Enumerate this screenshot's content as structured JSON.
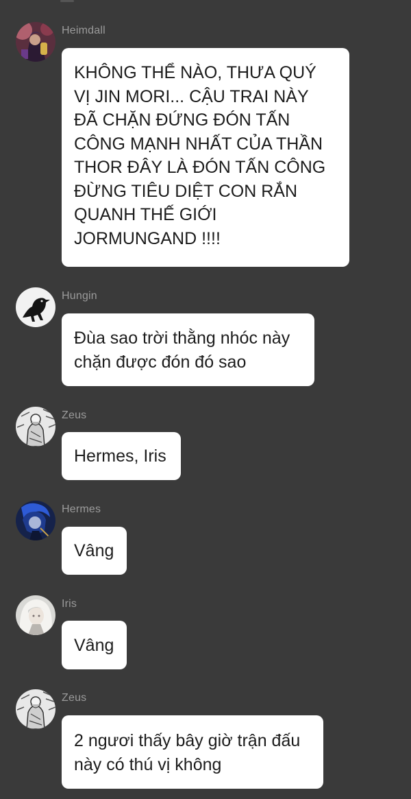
{
  "messages": [
    {
      "sender": "Heimdall",
      "avatar_icon": "heimdall-avatar-icon",
      "lines": [
        "KHÔNG THỂ NÀO, THƯA QUÝ",
        "VỊ JIN MORI... CẬU TRAI NÀY",
        "ĐÃ CHẶN ĐỨNG ĐÓN TẤN",
        "CÔNG MẠNH NHẤT CỦA THẦN",
        "THOR ĐÂY LÀ ĐÓN TẤN CÔNG",
        "ĐỪNG TIÊU DIỆT CON RẮN",
        "QUANH THẾ GIỚI",
        "JORMUNGAND !!!!"
      ]
    },
    {
      "sender": "Hungin",
      "avatar_icon": "crow-avatar-icon",
      "lines": [
        "Đùa sao trời thằng nhóc này",
        "chặn được đón đó sao"
      ]
    },
    {
      "sender": "Zeus",
      "avatar_icon": "zeus-avatar-icon",
      "lines": [
        "Hermes, Iris"
      ]
    },
    {
      "sender": "Hermes",
      "avatar_icon": "hermes-avatar-icon",
      "lines": [
        "Vâng"
      ]
    },
    {
      "sender": "Iris",
      "avatar_icon": "iris-avatar-icon",
      "lines": [
        "Vâng"
      ]
    },
    {
      "sender": "Zeus",
      "avatar_icon": "zeus-avatar-icon",
      "lines": [
        "2 ngươi thấy bây giờ trận đấu",
        "này có thú vị không"
      ]
    }
  ],
  "colors": {
    "background": "#3a3a3a",
    "bubble": "#ffffff",
    "text": "#1c1c1c",
    "sender": "#9b9b9b"
  }
}
